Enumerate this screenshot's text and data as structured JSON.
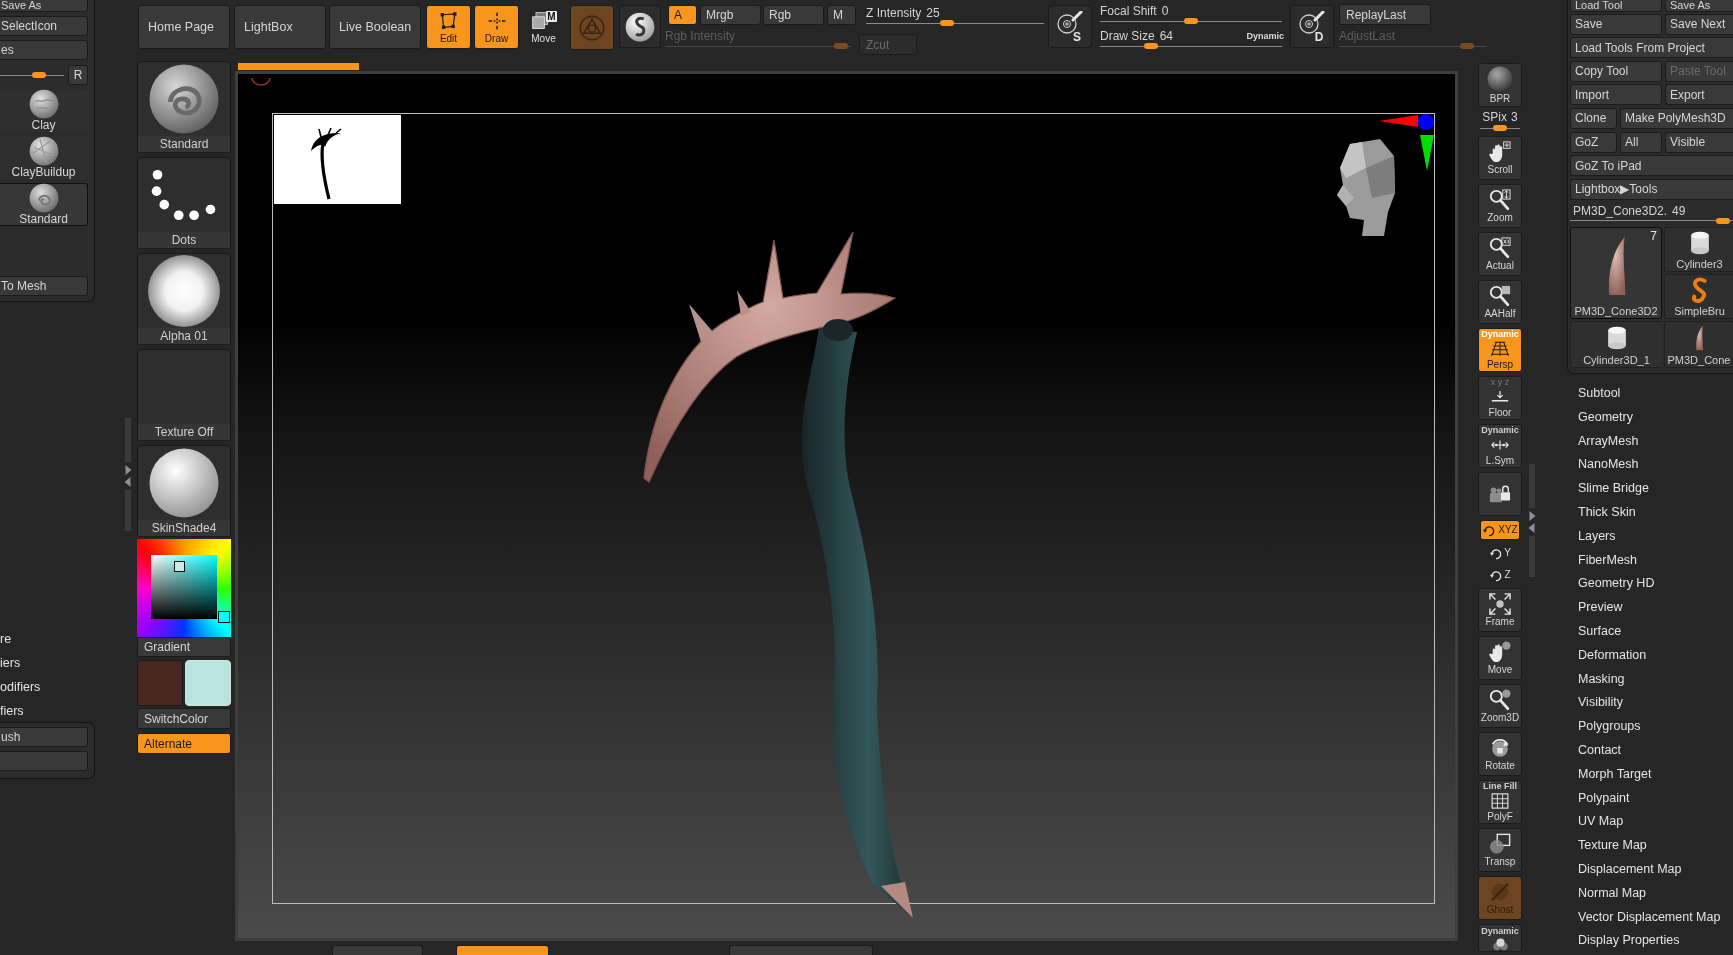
{
  "left_panel": {
    "top_buttons": [
      "Save As",
      "SelectIcon",
      "es"
    ],
    "size_slider": {
      "level": 0.64
    },
    "r_button": "R",
    "brushes": [
      {
        "label": "Clay",
        "kind": "clay",
        "selected": false
      },
      {
        "label": "ClayBuildup",
        "kind": "buildup",
        "selected": false
      },
      {
        "label": "Standard",
        "kind": "standard",
        "selected": true
      }
    ],
    "convert_button": "To Mesh"
  },
  "left_menu": [
    "re",
    "iers",
    "odifiers",
    "fiers"
  ],
  "left_lower_panel": {
    "button": "ush"
  },
  "toolbar": {
    "nav_buttons": [
      "Home Page",
      "LightBox",
      "Live Boolean"
    ],
    "modes": [
      {
        "label": "Edit",
        "kind": "edit",
        "on": true
      },
      {
        "label": "Draw",
        "kind": "draw",
        "on": true
      },
      {
        "label": "Move",
        "kind": "move",
        "on": false,
        "badge": "M"
      }
    ],
    "sculpt_button": {
      "on": true,
      "disabled": true
    },
    "color_modes": [
      {
        "label": "A",
        "selected": true
      },
      {
        "label": "Mrgb",
        "selected": false
      },
      {
        "label": "Rgb",
        "selected": false
      },
      {
        "label": "M",
        "selected": false
      }
    ],
    "rgb_intensity": {
      "label": "Rgb Intensity",
      "disabled": true,
      "level": 0.98
    },
    "zcut": {
      "label": "Zcut",
      "disabled": true
    },
    "z_intensity": {
      "label": "Z Intensity",
      "value": "25",
      "level": 0.45
    },
    "stroke_button": {
      "letter": "S"
    },
    "focal_shift": {
      "label": "Focal Shift",
      "value": "0",
      "level": 0.5
    },
    "draw_size": {
      "label": "Draw Size",
      "value": "64",
      "level": 0.26,
      "note": "Dynamic"
    },
    "dynamics_button": {
      "letter": "D"
    },
    "replay_last": "ReplayLast",
    "adjust_last": {
      "label": "AdjustLast",
      "disabled": true,
      "level": 0.9
    }
  },
  "shelf": {
    "items": [
      {
        "label": "Standard",
        "kind": "brush"
      },
      {
        "label": "Dots",
        "kind": "stroke"
      },
      {
        "label": "Alpha 01",
        "kind": "alpha"
      },
      {
        "label": "Texture Off",
        "kind": "texture"
      },
      {
        "label": "SkinShade4",
        "kind": "material"
      }
    ],
    "gradient_button": "Gradient",
    "colors": [
      {
        "color": "#4a2622",
        "selected": false
      },
      {
        "color": "#b9e4e2",
        "selected": true
      }
    ],
    "switch_button": "SwitchColor",
    "alternate": {
      "label": "Alternate",
      "on": true
    }
  },
  "view_toolbar": [
    {
      "kind": "render",
      "label": "BPR",
      "on": false,
      "disabled": false
    },
    {
      "kind": "slider",
      "label": "SPix",
      "value": "3",
      "level": 0.5
    },
    {
      "kind": "pan",
      "label": "Scroll",
      "on": false,
      "disabled": false
    },
    {
      "kind": "zoom",
      "label": "Zoom",
      "on": false,
      "disabled": false
    },
    {
      "kind": "actual",
      "label": "Actual",
      "on": false,
      "disabled": false
    },
    {
      "kind": "aahalf",
      "label": "AAHalf",
      "on": false,
      "disabled": false
    },
    {
      "kind": "perspective",
      "label": "Persp",
      "caption": "Dynamic",
      "on": true,
      "disabled": false
    },
    {
      "kind": "floor",
      "label": "Floor",
      "caption": "x y z",
      "on": false,
      "disabled": false
    },
    {
      "kind": "symmetry",
      "label": "L.Sym",
      "caption": "Dynamic",
      "on": false,
      "disabled": false
    },
    {
      "kind": "lock",
      "on": false,
      "disabled": false
    },
    {
      "kind": "axis",
      "label": "XYZ",
      "on": true,
      "disabled": false
    },
    {
      "kind": "axis",
      "label": "Y",
      "on": false,
      "disabled": false
    },
    {
      "kind": "axis",
      "label": "Z",
      "on": false,
      "disabled": false
    },
    {
      "kind": "frame",
      "label": "Frame",
      "on": false,
      "disabled": false
    },
    {
      "kind": "move",
      "label": "Move",
      "on": false,
      "disabled": false
    },
    {
      "kind": "zoom3d",
      "label": "Zoom3D",
      "on": false,
      "disabled": false
    },
    {
      "kind": "rotate",
      "label": "Rotate",
      "on": false,
      "disabled": false
    },
    {
      "kind": "polyframe",
      "label": "PolyF",
      "caption": "Line Fill",
      "on": false,
      "disabled": false
    },
    {
      "kind": "transparency",
      "label": "Transp",
      "on": false,
      "disabled": false
    },
    {
      "kind": "ghost",
      "label": "Ghost",
      "on": true,
      "disabled": true
    },
    {
      "kind": "solo",
      "caption": "Dynamic",
      "on": false,
      "disabled": false
    }
  ],
  "tool_panel": {
    "button_rows": [
      [
        {
          "label": "Load Tool",
          "disabled": false
        },
        {
          "label": "Save As",
          "disabled": false
        }
      ],
      [
        {
          "label": "Save",
          "disabled": false
        },
        {
          "label": "Save Next",
          "disabled": false
        }
      ],
      [
        {
          "label": "Load Tools From Project",
          "disabled": false
        }
      ],
      [
        {
          "label": "Copy Tool",
          "disabled": false
        },
        {
          "label": "Paste Tool",
          "disabled": true
        }
      ],
      [
        {
          "label": "Import",
          "disabled": false
        },
        {
          "label": "Export",
          "disabled": false
        }
      ],
      [
        {
          "label": "Clone",
          "disabled": false
        },
        {
          "label": "Make PolyMesh3D",
          "disabled": false
        }
      ],
      [
        {
          "label": "GoZ",
          "disabled": false
        },
        {
          "label": "All",
          "disabled": false
        },
        {
          "label": "Visible",
          "disabled": false
        }
      ],
      [
        {
          "label": "GoZ To iPad",
          "disabled": false
        }
      ],
      [
        {
          "label": "Lightbox▶Tools",
          "disabled": false
        }
      ]
    ],
    "subtool_slider": {
      "label": "PM3D_Cone3D2.",
      "value": "49",
      "level": 0.97
    },
    "thumbnails": [
      {
        "label": "PM3D_Cone3D2",
        "kind": "cone",
        "count": "7",
        "selected": true
      },
      {
        "label": "Cylinder3",
        "kind": "cylinder",
        "selected": false
      },
      {
        "label": "SimpleBru",
        "kind": "spiral",
        "selected": false
      },
      {
        "label": "Cylinder3D_1",
        "kind": "cylinder",
        "selected": false
      },
      {
        "label": "PM3D_Cone",
        "kind": "cone",
        "selected": false
      }
    ]
  },
  "tool_menu": [
    "Subtool",
    "Geometry",
    "ArrayMesh",
    "NanoMesh",
    "Slime Bridge",
    "Thick Skin",
    "Layers",
    "FiberMesh",
    "Geometry HD",
    "Preview",
    "Surface",
    "Deformation",
    "Masking",
    "Visibility",
    "Polygroups",
    "Contact",
    "Morph Target",
    "Polypaint",
    "UV Map",
    "Texture Map",
    "Displacement Map",
    "Normal Map",
    "Vector Displacement Map",
    "Display Properties"
  ],
  "bottom_tabs": [
    {
      "selected": false
    },
    {
      "selected": true
    },
    {
      "selected": false
    }
  ]
}
